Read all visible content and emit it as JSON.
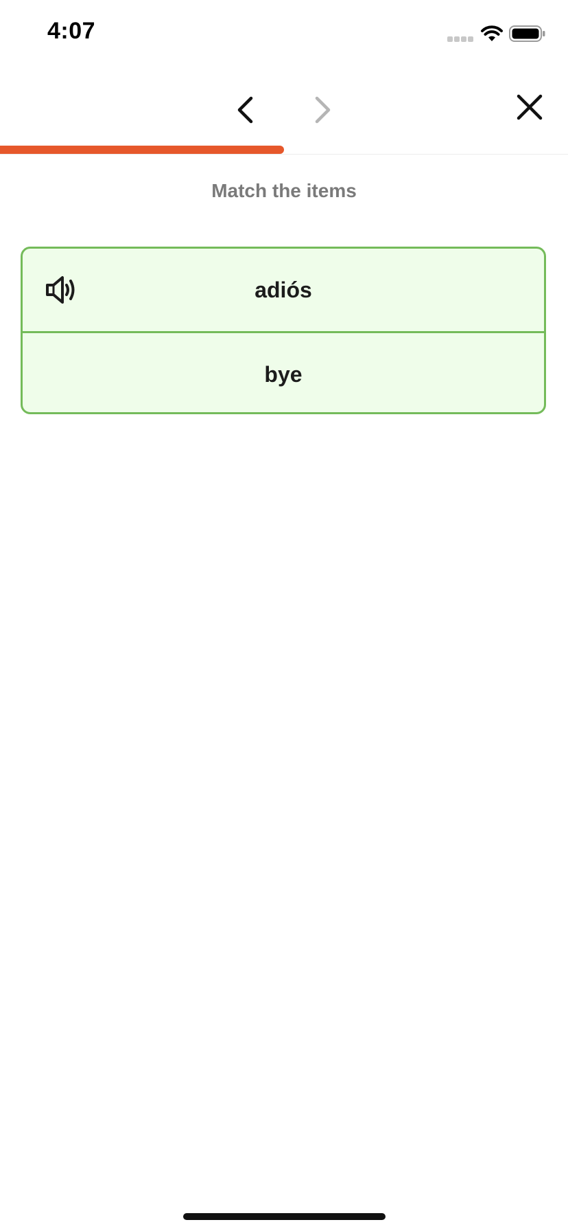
{
  "status_bar": {
    "time": "4:07",
    "icons": [
      "signal-icon",
      "wifi-icon",
      "battery-icon"
    ]
  },
  "nav": {
    "icons": [
      "chevron-left-icon",
      "chevron-right-icon",
      "close-icon"
    ],
    "next_enabled": false
  },
  "progress": {
    "fraction": 0.5,
    "color": "#e6582b"
  },
  "exercise": {
    "instruction": "Match the items",
    "pairs": [
      {
        "word": "adiós",
        "translation": "bye",
        "matched": true
      }
    ]
  },
  "colors": {
    "match_border": "#74bb5a",
    "match_background": "#effdea",
    "instruction_text": "#7a7a7a"
  }
}
